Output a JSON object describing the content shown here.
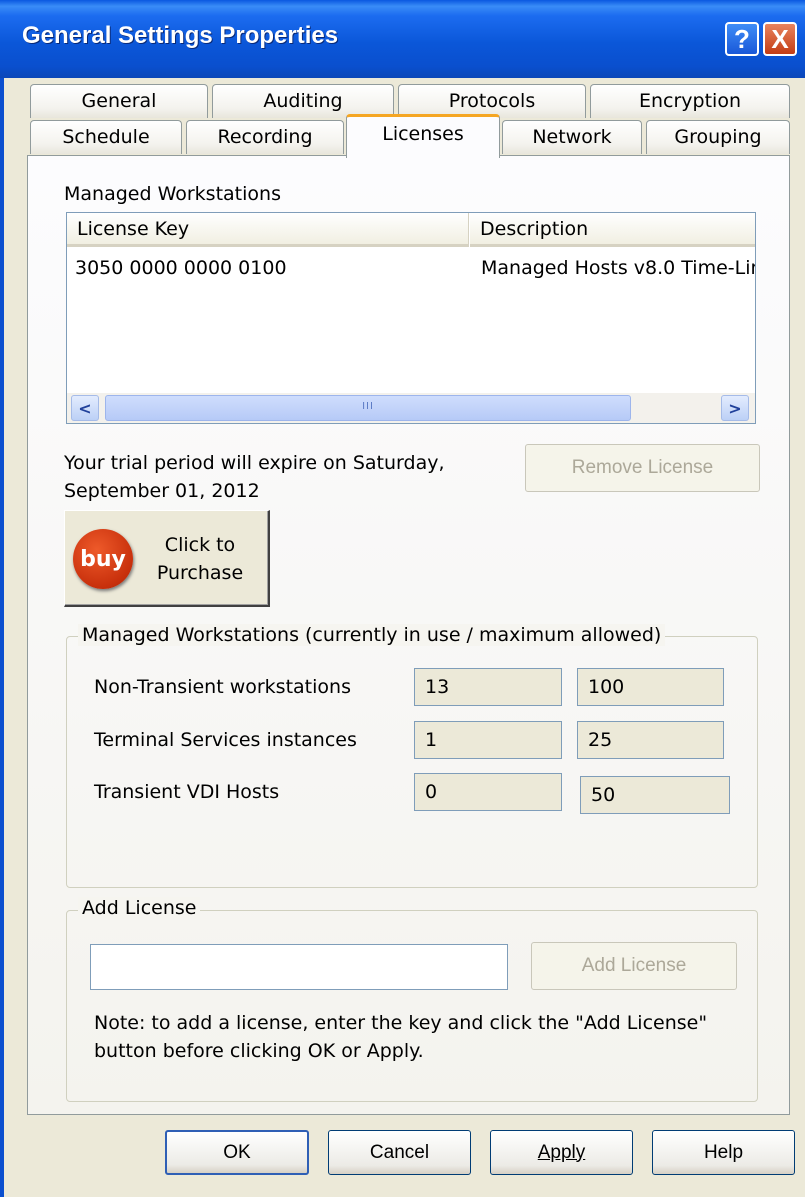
{
  "window": {
    "title": "General Settings Properties",
    "help_glyph": "?",
    "close_glyph": "X"
  },
  "tabs": {
    "row_back": [
      "General",
      "Auditing",
      "Protocols",
      "Encryption"
    ],
    "row_front": [
      "Schedule",
      "Recording",
      "Licenses",
      "Network",
      "Grouping"
    ],
    "active": "Licenses"
  },
  "managed": {
    "heading": "Managed Workstations",
    "columns": [
      "License Key",
      "Description"
    ],
    "rows": [
      {
        "key": "3050 0000 0000 0100",
        "description": "Managed Hosts v8.0 Time-Lir"
      }
    ],
    "scroll_left": "<",
    "scroll_right": ">",
    "thumb_grip": "III"
  },
  "trial": {
    "line1": "Your trial period will expire on Saturday,",
    "line2": "September 01, 2012"
  },
  "remove_license": "Remove License",
  "buy": {
    "icon_text": "buy",
    "line1": "Click to",
    "line2": "Purchase"
  },
  "usage": {
    "legend": "Managed Workstations (currently in use / maximum allowed)",
    "rows": [
      {
        "label": "Non-Transient workstations",
        "used": "13",
        "max": "100"
      },
      {
        "label": "Terminal Services instances",
        "used": "1",
        "max": "25"
      },
      {
        "label": "Transient VDI Hosts",
        "used": "0",
        "max": "50"
      }
    ]
  },
  "add_license": {
    "legend": "Add License",
    "input_value": "",
    "button": "Add License",
    "note_line1": "Note: to add a license, enter the key and click the \"Add License\"",
    "note_line2": "button before clicking OK or Apply."
  },
  "footer": {
    "ok": "OK",
    "cancel": "Cancel",
    "apply": "Apply",
    "help": "Help"
  }
}
